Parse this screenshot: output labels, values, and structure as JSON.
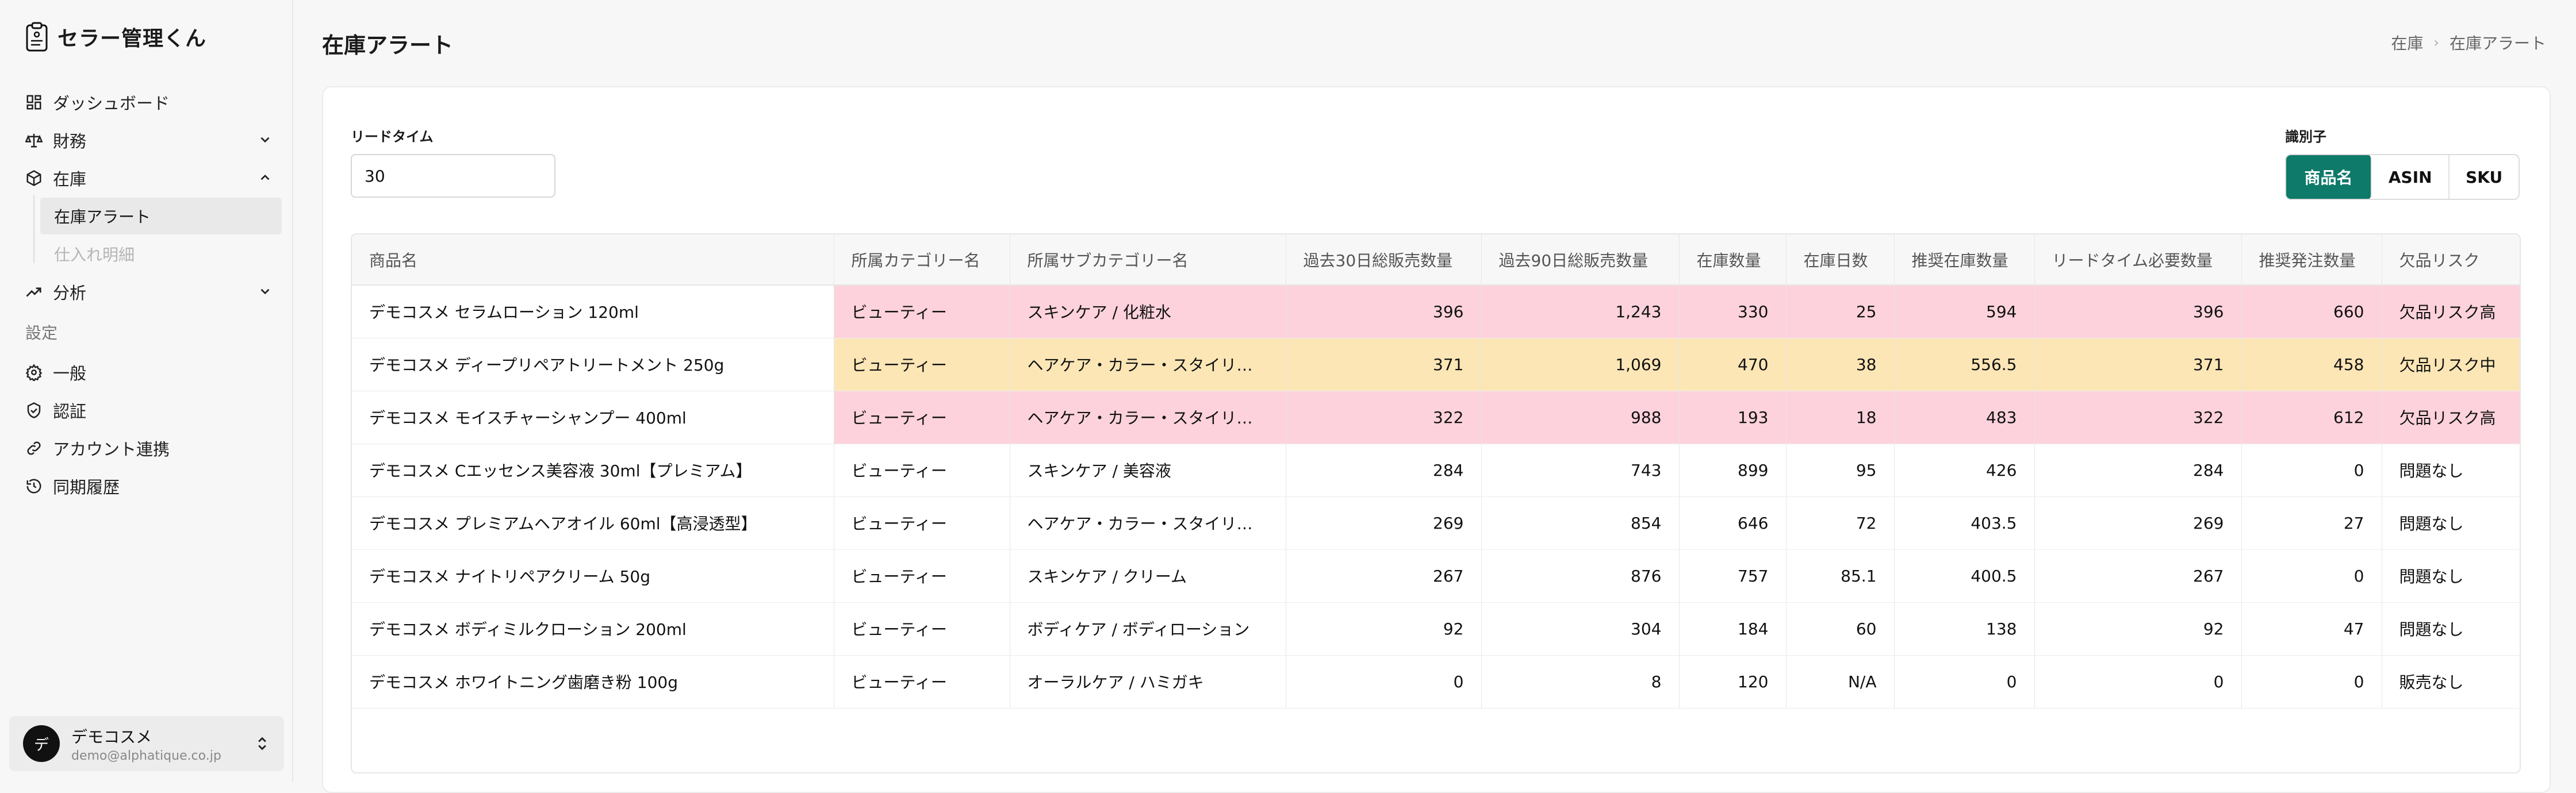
{
  "app": {
    "brand": "セラー管理くん"
  },
  "sidebar": {
    "dashboard": "ダッシュボード",
    "finance": "財務",
    "inventory": "在庫",
    "inventory_sub": [
      "在庫アラート",
      "仕入れ明細"
    ],
    "analytics": "分析",
    "settings_label": "設定",
    "settings": [
      "一般",
      "認証",
      "アカウント連携",
      "同期履歴"
    ],
    "user": {
      "initial": "デ",
      "name": "デモコスメ",
      "email": "demo@alphatique.co.jp"
    }
  },
  "header": {
    "title": "在庫アラート",
    "breadcrumb": [
      "在庫",
      "在庫アラート"
    ]
  },
  "controls": {
    "lead_time_label": "リードタイム",
    "lead_time_value": "30",
    "identifier_label": "識別子",
    "identifier_options": [
      "商品名",
      "ASIN",
      "SKU"
    ],
    "identifier_selected": "商品名"
  },
  "table": {
    "headers": [
      "商品名",
      "所属カテゴリー名",
      "所属サブカテゴリー名",
      "過去30日総販売数量",
      "過去90日総販売数量",
      "在庫数量",
      "在庫日数",
      "推奨在庫数量",
      "リードタイム必要数量",
      "推奨発注数量",
      "欠品リスク"
    ],
    "rows": [
      {
        "risk": "high",
        "cells": [
          "デモコスメ セラムローション 120ml",
          "ビューティー",
          "スキンケア / 化粧水",
          "396",
          "1,243",
          "330",
          "25",
          "594",
          "396",
          "660",
          "欠品リスク高"
        ]
      },
      {
        "risk": "mid",
        "cells": [
          "デモコスメ ディープリペアトリートメント 250g",
          "ビューティー",
          "ヘアケア・カラー・スタイリング",
          "371",
          "1,069",
          "470",
          "38",
          "556.5",
          "371",
          "458",
          "欠品リスク中"
        ]
      },
      {
        "risk": "high",
        "cells": [
          "デモコスメ モイスチャーシャンプー 400ml",
          "ビューティー",
          "ヘアケア・カラー・スタイリング",
          "322",
          "988",
          "193",
          "18",
          "483",
          "322",
          "612",
          "欠品リスク高"
        ]
      },
      {
        "risk": "none",
        "cells": [
          "デモコスメ Cエッセンス美容液 30ml【プレミアム】",
          "ビューティー",
          "スキンケア / 美容液",
          "284",
          "743",
          "899",
          "95",
          "426",
          "284",
          "0",
          "問題なし"
        ]
      },
      {
        "risk": "none",
        "cells": [
          "デモコスメ プレミアムヘアオイル 60ml【高浸透型】",
          "ビューティー",
          "ヘアケア・カラー・スタイリング",
          "269",
          "854",
          "646",
          "72",
          "403.5",
          "269",
          "27",
          "問題なし"
        ]
      },
      {
        "risk": "none",
        "cells": [
          "デモコスメ ナイトリペアクリーム 50g",
          "ビューティー",
          "スキンケア / クリーム",
          "267",
          "876",
          "757",
          "85.1",
          "400.5",
          "267",
          "0",
          "問題なし"
        ]
      },
      {
        "risk": "none",
        "cells": [
          "デモコスメ ボディミルクローション 200ml",
          "ビューティー",
          "ボディケア / ボディローション",
          "92",
          "304",
          "184",
          "60",
          "138",
          "92",
          "47",
          "問題なし"
        ]
      },
      {
        "risk": "none",
        "cells": [
          "デモコスメ ホワイトニング歯磨き粉 100g",
          "ビューティー",
          "オーラルケア / ハミガキ",
          "0",
          "8",
          "120",
          "N/A",
          "0",
          "0",
          "0",
          "販売なし"
        ]
      }
    ]
  },
  "colors": {
    "accent": "#0e7a69",
    "risk_high": "#fdd2dc",
    "risk_mid": "#fce6b6"
  }
}
